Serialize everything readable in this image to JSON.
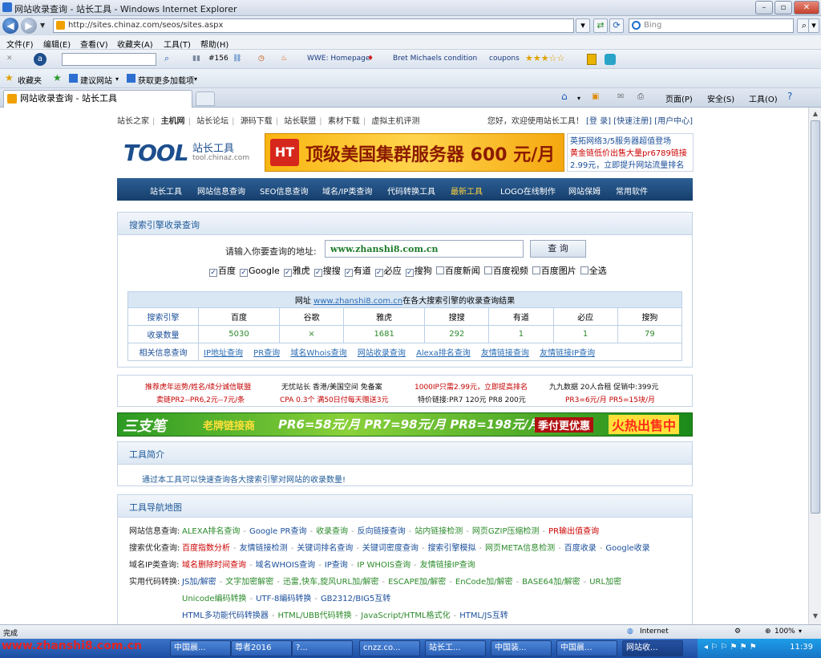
{
  "window": {
    "title": "网站收录查询 - 站长工具 - Windows Internet Explorer"
  },
  "address": {
    "url": "http://sites.chinaz.com/seos/sites.aspx",
    "search_placeholder": "Bing"
  },
  "menu": [
    "文件(F)",
    "编辑(E)",
    "查看(V)",
    "收藏夹(A)",
    "工具(T)",
    "帮助(H)"
  ],
  "toolbar": {
    "count": "#156",
    "link1": "WWE: Homepage",
    "link2": "Bret Michaels condition",
    "link3": "coupons"
  },
  "favorites": {
    "favorites_label": "收藏夹",
    "suggested": "建议网站",
    "more_addons": "获取更多加载项"
  },
  "tab": {
    "title": "网站收录查询 - 站长工具",
    "page": "页面(P)",
    "safety": "安全(S)",
    "tools": "工具(O)"
  },
  "topnav": {
    "links": [
      "站长之家",
      "主机网",
      "站长论坛",
      "源码下载",
      "站长联盟",
      "素材下载",
      "虚拟主机评测"
    ],
    "welcome": "您好，欢迎使用站长工具！",
    "login": "[登 录]",
    "register": "[快速注册]",
    "user_center": "[用户中心]"
  },
  "logo": {
    "main": "TOOL",
    "cn": "站长工具",
    "domain": "tool.chinaz.com"
  },
  "banner1": {
    "mark": "HT",
    "text": "顶级美国集群服务器 600 元/月"
  },
  "ad1": {
    "line1": "英拓网络3/5服务器超值登场",
    "line2": "黄金链低价出售大量pr6789链接",
    "line3": "2.99元，立即提升网站流量排名"
  },
  "mainnav": [
    "站长工具",
    "网站信息查询",
    "SEO信息查询",
    "域名/IP类查询",
    "代码转换工具",
    "最新工具",
    "LOGO在线制作",
    "网站保姆",
    "常用软件"
  ],
  "search_panel": {
    "title": "搜索引擎收录查询",
    "label": "请输入你要查询的地址:",
    "value": "www.zhanshi8.com.cn",
    "button": "查 询",
    "engines": [
      {
        "name": "百度",
        "checked": true
      },
      {
        "name": "Google",
        "checked": true
      },
      {
        "name": "雅虎",
        "checked": true
      },
      {
        "name": "搜搜",
        "checked": true
      },
      {
        "name": "有道",
        "checked": true
      },
      {
        "name": "必应",
        "checked": true
      },
      {
        "name": "搜狗",
        "checked": true
      },
      {
        "name": "百度新闻",
        "checked": false
      },
      {
        "name": "百度视频",
        "checked": false
      },
      {
        "name": "百度图片",
        "checked": false
      },
      {
        "name": "全选",
        "checked": false
      }
    ]
  },
  "results": {
    "caption_prefix": "网址",
    "caption_link": "www.zhanshi8.com.cn",
    "caption_suffix": "在各大搜索引擎的收录查询结果",
    "header_label": "搜索引擎",
    "engines": [
      "百度",
      "谷歌",
      "雅虎",
      "搜搜",
      "有道",
      "必应",
      "搜狗"
    ],
    "count_label": "收录数量",
    "counts": [
      "5030",
      "×",
      "1681",
      "292",
      "1",
      "1",
      "79"
    ],
    "related_label": "相关信息查询",
    "related_links": [
      "IP地址查询",
      "PR查询",
      "域名Whois查询",
      "网站收录查询",
      "Alexa排名查询",
      "友情链接查询",
      "友情链接IP查询"
    ]
  },
  "ads_text": {
    "a1": "推荐虎年运势/姓名/续分诚信联盟",
    "a2": "卖链PR2--PR6,2元--7元/条",
    "b1": "无忧站长 香港/美国空间 免备案",
    "b2": "CPA 0.3个 满50日付每天赠送3元",
    "c1": "1000IP只需2.99元，立即提高排名",
    "c2": "特价链接:PR7 120元 PR8 200元",
    "d1": "九九数据 20人合租 促销中:399元",
    "d2": "PR3=6元/月 PR5=15块/月"
  },
  "banner2": {
    "brand": "三支笔",
    "tag": "老牌链接商",
    "prices": "PR6=58元/月 PR7=98元/月 PR8=198元/月",
    "promo": "季付更优惠",
    "hot": "火热出售中"
  },
  "intro": {
    "title": "工具简介",
    "text": "通过本工具可以快速查询各大搜索引擎对网站的收录数量!"
  },
  "toolmap": {
    "title": "工具导航地图",
    "rows": [
      {
        "label": "网站信息查询:",
        "items": [
          "ALEXA排名查询",
          "Google PR查询",
          "收录查询",
          "反向链接查询",
          "站内链接检测",
          "网页GZIP压缩检测",
          "PR输出值查询"
        ]
      },
      {
        "label": "搜索优化查询:",
        "items": [
          "百度指数分析",
          "友情链接检测",
          "关键词排名查询",
          "关键词密度查询",
          "搜索引擎模拟",
          "网页META信息检测",
          "百度收录",
          "Google收录"
        ]
      },
      {
        "label": "域名IP类查询:",
        "items": [
          "域名删除时间查询",
          "域名WHOIS查询",
          "IP查询",
          "IP WHOIS查询",
          "友情链接IP查询"
        ]
      },
      {
        "label": "实用代码转换:",
        "items": [
          "JS加/解密",
          "文字加密解密",
          "迅雷,快车,旋风URL加/解密",
          "ESCAPE加/解密",
          "EnCode加/解密",
          "BASE64加/解密",
          "URL加密"
        ]
      },
      {
        "label": "",
        "items": [
          "Unicode编码转换",
          "UTF-8编码转换",
          "GB2312/BIG5互转"
        ]
      },
      {
        "label": "",
        "items": [
          "HTML多功能代码转换器",
          "HTML/UBB代码转换",
          "JavaScript/HTML格式化",
          "HTML/JS互转"
        ]
      }
    ]
  },
  "status": {
    "text": "完成",
    "zone": "Internet",
    "zoom": "100%"
  },
  "taskbar": {
    "brand": "www.zhanshi8.com.cn",
    "items": [
      "中国晨...",
      "尊者2016",
      "?...",
      "cnzz.co...",
      "站长工...",
      "中国装...",
      "中国晨...",
      "网站收..."
    ],
    "clock": "11:39"
  },
  "colors": {
    "nav_bg": "#1f4f82",
    "link_blue": "#1a4e9a",
    "green": "#2b8a2b",
    "red": "#c40000"
  }
}
